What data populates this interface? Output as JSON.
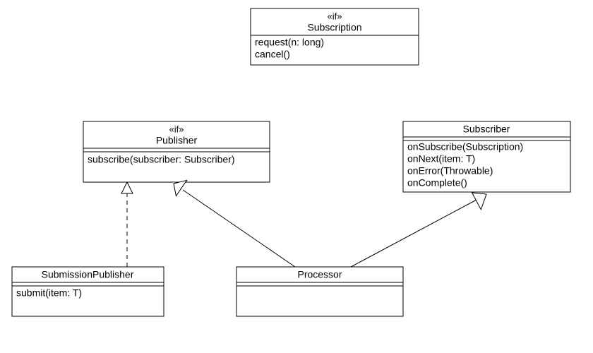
{
  "diagram": {
    "type": "uml-class-diagram",
    "classes": {
      "subscription": {
        "stereotype": "«if»",
        "name": "Subscription",
        "methods": [
          "request(n: long)",
          "cancel()"
        ]
      },
      "publisher": {
        "stereotype": "«if»",
        "name": "Publisher",
        "methods": [
          "subscribe(subscriber: Subscriber)"
        ]
      },
      "subscriber": {
        "name": "Subscriber",
        "methods": [
          "onSubscribe(Subscription)",
          "onNext(item: T)",
          "onError(Throwable)",
          "onComplete()"
        ]
      },
      "submissionPublisher": {
        "name": "SubmissionPublisher",
        "methods": [
          "submit(item: T)"
        ]
      },
      "processor": {
        "name": "Processor",
        "methods": []
      }
    },
    "relationships": [
      {
        "from": "submissionPublisher",
        "to": "publisher",
        "type": "realization"
      },
      {
        "from": "processor",
        "to": "publisher",
        "type": "generalization"
      },
      {
        "from": "processor",
        "to": "subscriber",
        "type": "generalization"
      }
    ]
  }
}
